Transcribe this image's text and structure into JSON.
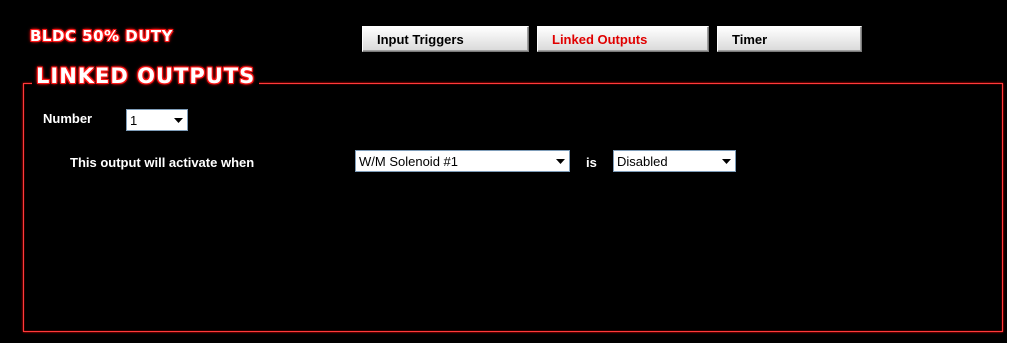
{
  "app": {
    "title": "BLDC 50% DUTY"
  },
  "tabs": [
    {
      "label": "Input Triggers",
      "active": false
    },
    {
      "label": "Linked Outputs",
      "active": true
    },
    {
      "label": "Timer",
      "active": false
    }
  ],
  "section": {
    "title": "LINKED OUTPUTS",
    "number_label": "Number",
    "number_value": "1",
    "activate_label": "This output will activate when",
    "source_value": "W/M Solenoid #1",
    "is_label": "is",
    "state_value": "Disabled"
  },
  "colors": {
    "background": "#000000",
    "accent": "#ff2020",
    "active_tab_text": "#e00000"
  },
  "icons": {
    "dropdown": "chevron-down-icon"
  }
}
